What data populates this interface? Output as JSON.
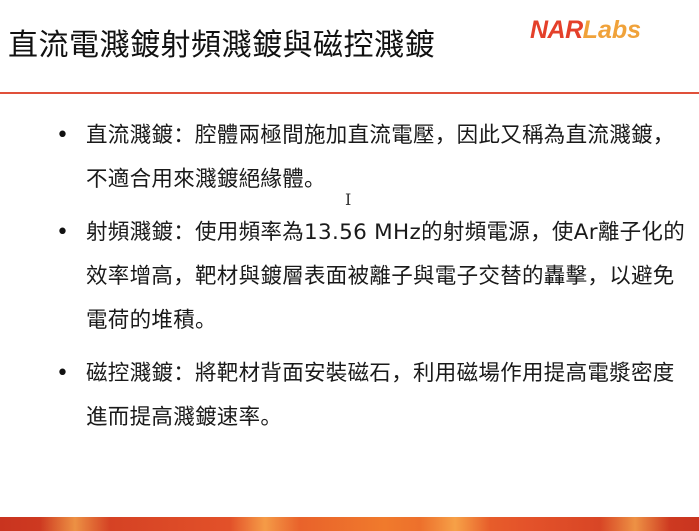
{
  "slide": {
    "title": "直流電濺鍍射頻濺鍍與磁控濺鍍",
    "logo": {
      "part1": "NAR",
      "part2": "Labs"
    },
    "bullets": [
      {
        "symbol": "•",
        "text": "直流濺鍍：腔體兩極間施加直流電壓，因此又稱為直流濺鍍，不適合用來濺鍍絕緣體。"
      },
      {
        "symbol": "•",
        "text": "射頻濺鍍：使用頻率為13.56 MHz的射頻電源，使Ar離子化的效率增高，靶材與鍍層表面被離子與電子交替的轟擊，以避免電荷的堆積。"
      },
      {
        "symbol": "•",
        "text": "磁控濺鍍：將靶材背面安裝磁石，利用磁場作用提高電漿密度進而提高濺鍍速率。"
      }
    ]
  },
  "colors": {
    "accent_red": "#e4402a",
    "accent_orange": "#f0a23a",
    "rule": "#e0503a"
  },
  "icons": {
    "cursor": "text-cursor-icon"
  }
}
